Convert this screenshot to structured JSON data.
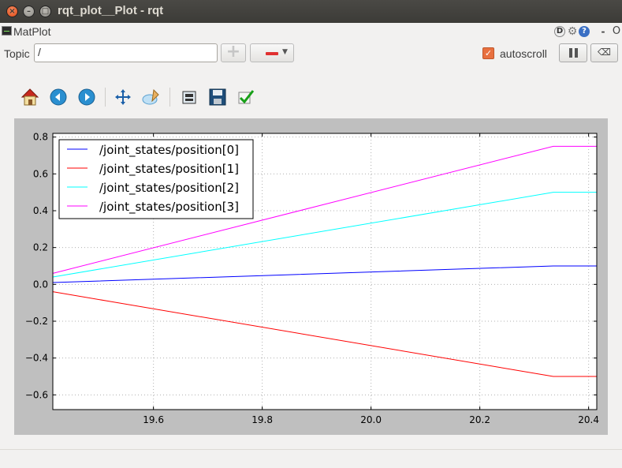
{
  "window": {
    "title": "rqt_plot__Plot - rqt"
  },
  "plugin": {
    "title": "MatPlot",
    "d_label": "D",
    "dash_label": "-",
    "o_label": "O"
  },
  "topic": {
    "label": "Topic",
    "value": "/"
  },
  "autoscroll": {
    "label": "autoscroll",
    "checked": true
  },
  "toolbar": {
    "icons": [
      "home-icon",
      "back-icon",
      "forward-icon",
      "pan-icon",
      "zoom-icon",
      "subplots-icon",
      "save-icon",
      "edit-icon"
    ]
  },
  "chart_data": {
    "type": "line",
    "xlim": [
      19.415,
      20.415
    ],
    "ylim": [
      -0.68,
      0.82
    ],
    "xticks": [
      "19.6",
      "19.8",
      "20.0",
      "20.2",
      "20.4"
    ],
    "yticks": [
      "0.8",
      "0.6",
      "0.4",
      "0.2",
      "0.0",
      "−0.2",
      "−0.4",
      "−0.6"
    ],
    "grid": true,
    "legend_position": "upper-left",
    "series": [
      {
        "name": "/joint_states/position[0]",
        "color": "#0000ff",
        "x": [
          19.415,
          20.335,
          20.415
        ],
        "y": [
          0.01,
          0.1,
          0.1
        ]
      },
      {
        "name": "/joint_states/position[1]",
        "color": "#ff0000",
        "x": [
          19.415,
          20.335,
          20.415
        ],
        "y": [
          -0.04,
          -0.5,
          -0.5
        ]
      },
      {
        "name": "/joint_states/position[2]",
        "color": "#00ffff",
        "x": [
          19.415,
          20.335,
          20.415
        ],
        "y": [
          0.04,
          0.5,
          0.5
        ]
      },
      {
        "name": "/joint_states/position[3]",
        "color": "#ff00ff",
        "x": [
          19.415,
          20.335,
          20.415
        ],
        "y": [
          0.06,
          0.75,
          0.75
        ]
      }
    ]
  }
}
